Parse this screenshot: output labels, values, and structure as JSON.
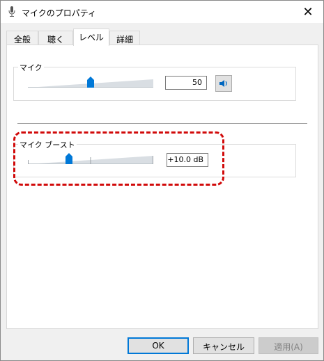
{
  "window": {
    "title": "マイクのプロパティ"
  },
  "tabs": [
    {
      "label": "全般"
    },
    {
      "label": "聴く"
    },
    {
      "label": "レベル"
    },
    {
      "label": "詳細"
    }
  ],
  "active_tab": "レベル",
  "microphone": {
    "label": "マイク",
    "value": "50",
    "level_percent": 50
  },
  "boost": {
    "label": "マイク ブースト",
    "value": "+10.0 dB",
    "level_percent": 33
  },
  "buttons": {
    "ok": "OK",
    "cancel": "キャンセル",
    "apply": "適用(A)"
  },
  "colors": {
    "accent": "#0078d7",
    "highlight": "#d10a0a"
  }
}
